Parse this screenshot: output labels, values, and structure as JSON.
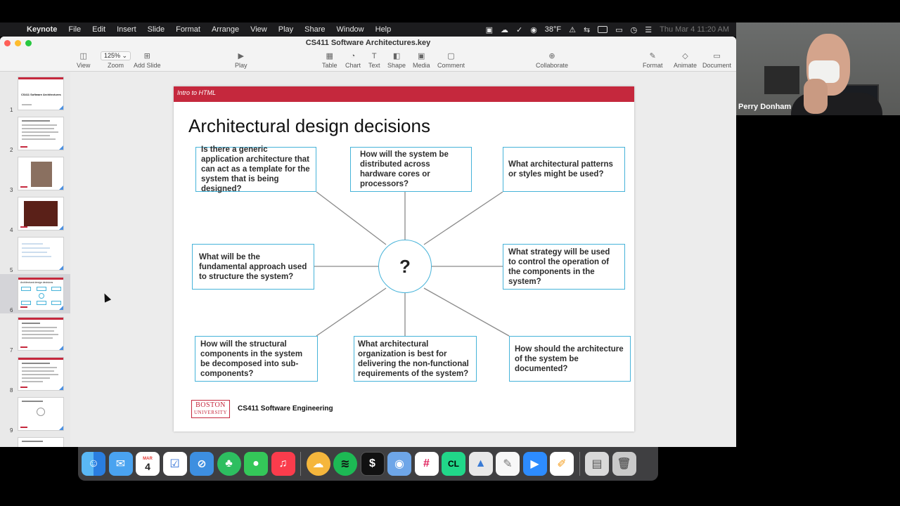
{
  "menubar": {
    "app": "Keynote",
    "items": [
      "File",
      "Edit",
      "Insert",
      "Slide",
      "Format",
      "Arrange",
      "View",
      "Play",
      "Share",
      "Window",
      "Help"
    ],
    "temperature": "38°F",
    "clock": "Thu Mar 4  11:20 AM"
  },
  "window": {
    "title": "CS411 Software Architectures.key",
    "toolbar": {
      "view": "View",
      "zoom_value": "125% ⌄",
      "zoom": "Zoom",
      "add_slide": "Add Slide",
      "play": "Play",
      "table": "Table",
      "chart": "Chart",
      "text": "Text",
      "shape": "Shape",
      "media": "Media",
      "comment": "Comment",
      "collaborate": "Collaborate",
      "format": "Format",
      "animate": "Animate",
      "document": "Document"
    }
  },
  "navigator": {
    "slides": [
      "1",
      "2",
      "3",
      "4",
      "5",
      "6",
      "7",
      "8",
      "9"
    ],
    "selected": "6",
    "thumb1_title": "CS411 Software Architectures",
    "thumb6_title": "Architectural design decisions"
  },
  "slide": {
    "header": "Intro to HTML",
    "title": "Architectural design decisions",
    "center": "?",
    "questions": {
      "q1": "Is there a generic application architecture that can act as a template for the system that is being designed?",
      "q2": "How will the system be distributed across hardware cores or processors?",
      "q3": "What architectural patterns or styles might be used?",
      "q4": "What will be the fundamental approach used to structure the system?",
      "q5": "What strategy will be used to control the operation of the components in the system?",
      "q6": "How will the structural components in the system be decomposed into sub-components?",
      "q7": "What architectural organization is best for delivering the non-functional requirements of the system?",
      "q8": "How should the architecture of the system be documented?"
    },
    "logo_line1": "BOSTON",
    "logo_line2": "UNIVERSITY",
    "footer": "CS411 Software Engineering"
  },
  "webcam": {
    "name": "Perry Donham"
  },
  "dock": {
    "calendar_month": "MAR",
    "calendar_day": "4",
    "apps": [
      "finder-icon",
      "mail-icon",
      "calendar-icon",
      "reminders-icon",
      "safari-icon",
      "evernote-icon",
      "messages-icon",
      "music-icon",
      "cloud-drive-icon",
      "spotify-icon",
      "terminal-icon",
      "preview-icon",
      "slack-icon",
      "clion-icon",
      "keynote-icon",
      "textedit-icon",
      "zoom-icon",
      "pages-icon",
      "downloads-icon",
      "trash-icon"
    ]
  },
  "colors": {
    "accent_red": "#c5283d",
    "box_border": "#46b3d9"
  }
}
